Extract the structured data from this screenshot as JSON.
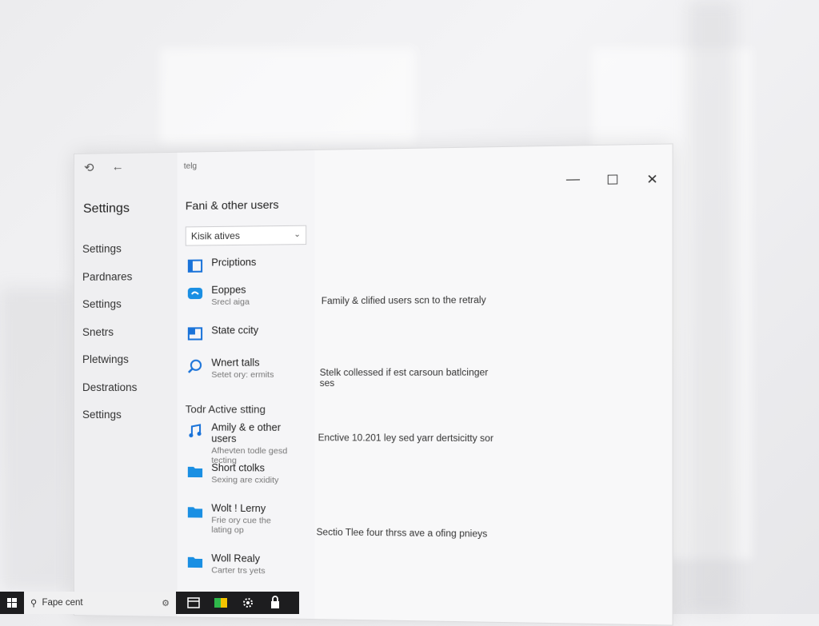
{
  "sidebar": {
    "back_icon": "back-arrow-icon",
    "title": "Settings",
    "items": [
      {
        "label": "Settings",
        "active": false
      },
      {
        "label": "Pardnares",
        "active": false
      },
      {
        "label": "Settings",
        "active": false
      },
      {
        "label": "Snetrs",
        "active": false
      },
      {
        "label": "Pletwings",
        "active": false
      },
      {
        "label": "Destrations",
        "active": true
      },
      {
        "label": "Settings",
        "active": false
      }
    ]
  },
  "middle": {
    "breadcrumb": "telg",
    "title": "Fani & other users",
    "search": {
      "value": "Kisik atives"
    },
    "items": [
      {
        "primary": "Prciptions",
        "secondary": "",
        "icon": "window-icon"
      },
      {
        "primary": "Eoppes",
        "secondary": "Srecl aiga",
        "icon": "cloud-icon"
      },
      {
        "primary": "State ccity",
        "secondary": "",
        "icon": "window-icon"
      },
      {
        "primary": "Wnert talls",
        "secondary": "Setet ory: ermits",
        "icon": "search-magnifier-icon"
      }
    ],
    "section_heading": "Todr Active stting",
    "section_items": [
      {
        "primary": "Amily & e other users",
        "secondary": "Afhevten todle gesd tecting",
        "icon": "music-note-icon"
      },
      {
        "primary": "Short ctolks",
        "secondary": "Sexing are cxidity",
        "icon": "folder-icon"
      },
      {
        "primary": "Wolt ! Lerny",
        "secondary": "Frie ory cue the lating op",
        "icon": "folder-icon"
      },
      {
        "primary": "Woll Realy",
        "secondary": "Carter trs yets",
        "icon": "folder-icon"
      }
    ]
  },
  "content": {
    "descriptions": [
      "Family & clified users scn to the retraly",
      "Stelk collessed if est carsoun batlcinger ses",
      "Enctive 10.201 ley sed yarr dertsicitty sor",
      "Sectio Tlee four thrss ave a ofing pnieys"
    ]
  },
  "window_controls": {
    "minimize": "—",
    "maximize": "☐",
    "close": "✕"
  },
  "taskbar": {
    "start_icon": "windows-logo-icon",
    "search_placeholder": "Fape cent",
    "search_icon": "search-icon",
    "mic_icon": "microphone-icon",
    "icons": [
      "task-view-icon",
      "store-icon",
      "settings-gear-icon",
      "lock-icon"
    ]
  },
  "colors": {
    "accent": "#1a73d9",
    "taskbar": "#1d1d1f"
  }
}
